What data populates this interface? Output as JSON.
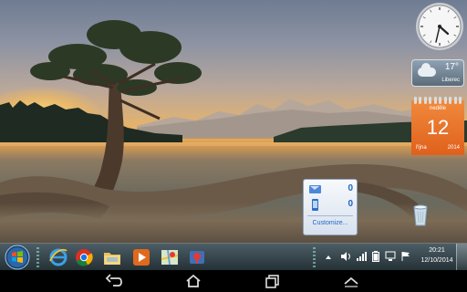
{
  "desktop": {
    "weather": {
      "temperature": "17°",
      "city": "Liberec"
    },
    "calendar": {
      "day_of_week": "neděle",
      "day": "12",
      "month": "října",
      "year": "2014"
    },
    "message_popup": {
      "email_count": "0",
      "sms_count": "0",
      "customize_label": "Customize..."
    },
    "clock": {
      "hour": 4,
      "minute": 39
    }
  },
  "taskbar": {
    "pinned": [
      "internet-explorer-icon",
      "chrome-icon",
      "folder-icon",
      "media-player-icon",
      "maps-icon",
      "network-map-icon"
    ],
    "tray": {
      "time": "20:21",
      "date": "12/10/2014"
    }
  },
  "navbar": {
    "buttons": [
      "back",
      "home",
      "recent-apps",
      "hide-keyboard"
    ]
  },
  "colors": {
    "taskbar": "#32464c",
    "calendar": "#e8702b",
    "popup_accent": "#1f65c4"
  }
}
